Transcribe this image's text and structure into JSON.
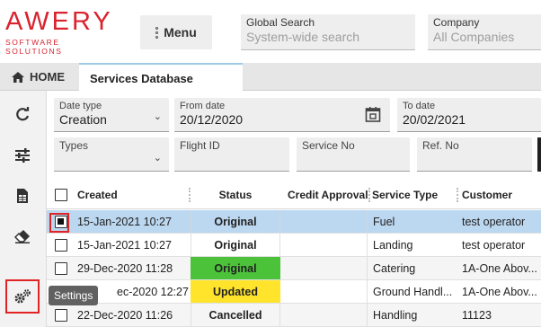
{
  "brand": {
    "name": "AWERY",
    "tagline": "SOFTWARE SOLUTIONS"
  },
  "header": {
    "menu_label": "Menu",
    "global_search": {
      "label": "Global Search",
      "placeholder": "System-wide search"
    },
    "company": {
      "label": "Company",
      "placeholder": "All Companies"
    }
  },
  "tabs": [
    {
      "label": "HOME",
      "icon": "home-icon"
    },
    {
      "label": "Services Database"
    }
  ],
  "sidebar": {
    "items": [
      {
        "icon": "refresh-icon"
      },
      {
        "icon": "sliders-icon"
      },
      {
        "icon": "spreadsheet-icon"
      },
      {
        "icon": "eraser-icon"
      },
      {
        "icon": "settings-gears-icon",
        "active": true
      }
    ],
    "tooltip": "Settings"
  },
  "filters": {
    "date_type": {
      "label": "Date type",
      "value": "Creation"
    },
    "from_date": {
      "label": "From date",
      "value": "20/12/2020"
    },
    "to_date": {
      "label": "To date",
      "value": "20/02/2021"
    },
    "types": {
      "label": "Types"
    },
    "flight_id": {
      "label": "Flight ID"
    },
    "service_no": {
      "label": "Service No"
    },
    "ref_no": {
      "label": "Ref. No"
    }
  },
  "table": {
    "columns": [
      "Created",
      "Status",
      "Credit Approval",
      "Service Type",
      "Customer"
    ],
    "rows": [
      {
        "created": "15-Jan-2021 10:27",
        "status": "Original",
        "credit_approval": "",
        "service_type": "Fuel",
        "customer": "test operator",
        "selected": true
      },
      {
        "created": "15-Jan-2021 10:27",
        "status": "Original",
        "credit_approval": "",
        "service_type": "Landing",
        "customer": "test operator",
        "selected": false
      },
      {
        "created": "29-Dec-2020 11:28",
        "status": "Original",
        "credit_approval": "",
        "service_type": "Catering",
        "customer": "1A-One Abov...",
        "selected": false,
        "status_color": "#4cc23a"
      },
      {
        "created": "ec-2020 12:27",
        "status": "Updated",
        "credit_approval": "",
        "service_type": "Ground Handl...",
        "customer": "1A-One Abov...",
        "selected": false,
        "status_color": "#ffe42b"
      },
      {
        "created": "22-Dec-2020 11:26",
        "status": "Cancelled",
        "credit_approval": "",
        "service_type": "Handling",
        "customer": "11123",
        "selected": false
      }
    ]
  },
  "colors": {
    "brand_red": "#d9232e",
    "selected_row": "#bcd7f0",
    "highlight_red": "#e02424"
  }
}
